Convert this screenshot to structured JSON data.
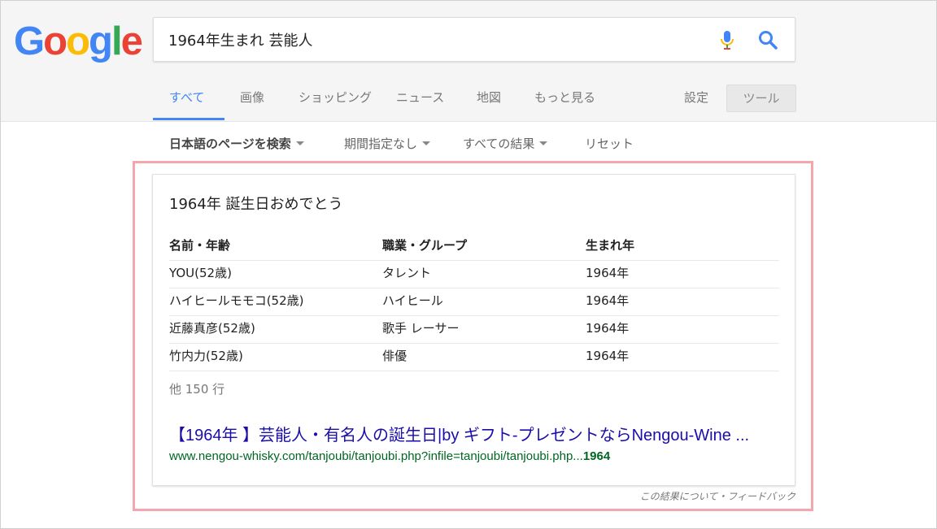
{
  "logo": {
    "letters": [
      "G",
      "o",
      "o",
      "g",
      "l",
      "e"
    ],
    "colors": [
      "#4285f4",
      "#ea4335",
      "#fbbc05",
      "#4285f4",
      "#34a853",
      "#ea4335"
    ]
  },
  "search": {
    "query": "1964年生まれ 芸能人",
    "mic_icon": "microphone-icon",
    "search_icon": "magnifier-icon"
  },
  "tabs": [
    {
      "label": "すべて",
      "active": true
    },
    {
      "label": "画像"
    },
    {
      "label": "ショッピング"
    },
    {
      "label": "ニュース"
    },
    {
      "label": "地図"
    },
    {
      "label": "もっと見る"
    }
  ],
  "settings_label": "設定",
  "tools_label": "ツール",
  "filters": [
    {
      "label": "日本語のページを検索"
    },
    {
      "label": "期間指定なし"
    },
    {
      "label": "すべての結果"
    },
    {
      "label": "リセット"
    }
  ],
  "card": {
    "title": "1964年 誕生日おめでとう",
    "columns": [
      "名前・年齢",
      "職業・グループ",
      "生まれ年"
    ],
    "rows": [
      [
        "YOU(52歳)",
        "タレント",
        "1964年"
      ],
      [
        "ハイヒールモモコ(52歳)",
        "ハイヒール",
        "1964年"
      ],
      [
        "近藤真彦(52歳)",
        "歌手 レーサー",
        "1964年"
      ],
      [
        "竹内力(52歳)",
        "俳優",
        "1964年"
      ]
    ],
    "more_rows": "他 150 行",
    "link_title": "【1964年 】芸能人・有名人の誕生日|by ギフト-プレゼントならNengou-Wine ...",
    "url_prefix": "www.nengou-whisky.com/tanjoubi/tanjoubi.php?infile=tanjoubi/tanjoubi.php...",
    "url_bold": "1964"
  },
  "feedback": "この結果について・フィードバック",
  "colors": {
    "accent": "#4285f4",
    "highlight_border": "#f4a6aa",
    "link": "#1a0dab",
    "url": "#006621"
  }
}
